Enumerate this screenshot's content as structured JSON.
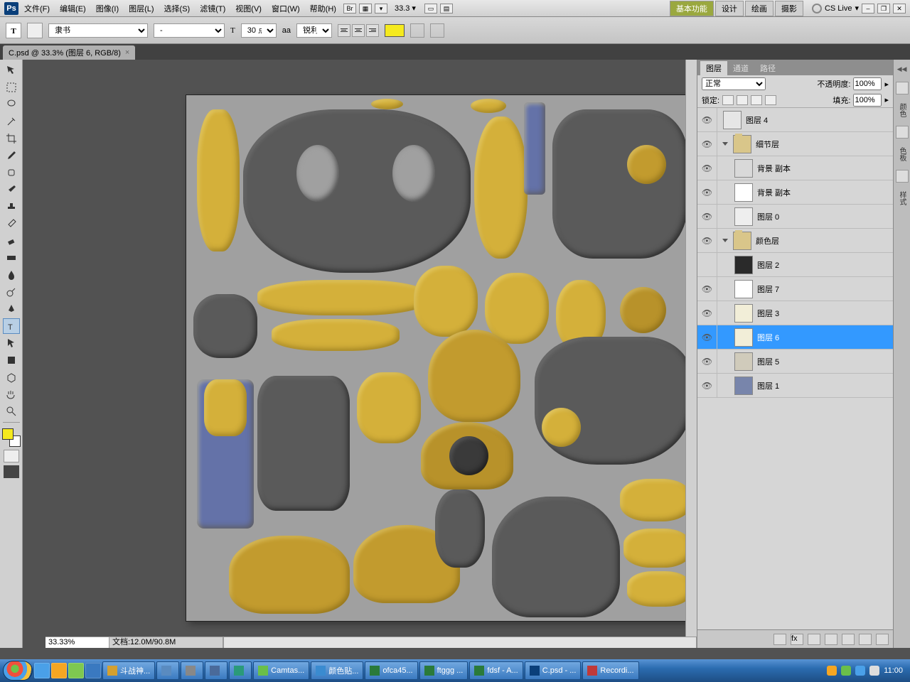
{
  "menu": {
    "items": [
      "文件(F)",
      "编辑(E)",
      "图像(I)",
      "图层(L)",
      "选择(S)",
      "滤镜(T)",
      "视图(V)",
      "窗口(W)",
      "帮助(H)"
    ],
    "zoom": "33.3",
    "workspaces": [
      "基本功能",
      "设计",
      "绘画",
      "摄影"
    ],
    "cslive": "CS Live"
  },
  "options": {
    "fontFamily": "隶书",
    "fontStyle": "-",
    "fontSize": "30 点",
    "fontSizeLabel": "T",
    "aaPrefix": "aa",
    "aaMode": "锐利",
    "colorSwatch": "#f5ea1e"
  },
  "docTab": "C.psd @ 33.3% (图层 6, RGB/8)",
  "statusBar": {
    "zoom": "33.33%",
    "docInfo": "文档:12.0M/90.8M"
  },
  "toolsFg": "#f5ea1e",
  "layersPanel": {
    "tabs": [
      "图层",
      "通道",
      "路径"
    ],
    "blendMode": "正常",
    "opacityLabel": "不透明度:",
    "opacity": "100%",
    "lockLabel": "锁定:",
    "fillLabel": "填充:",
    "fill": "100%",
    "rows": [
      {
        "vis": true,
        "indent": 0,
        "type": "layer",
        "thumb": "#e6e6e6",
        "name": "图层 4"
      },
      {
        "vis": true,
        "indent": 0,
        "type": "group",
        "name": "细节层"
      },
      {
        "vis": true,
        "indent": 1,
        "type": "layer",
        "thumb": "#d9d9d9",
        "name": "背景 副本"
      },
      {
        "vis": true,
        "indent": 1,
        "type": "layer",
        "thumb": "#ffffff",
        "name": "背景 副本"
      },
      {
        "vis": true,
        "indent": 1,
        "type": "layer",
        "thumb": "#eeeeee",
        "name": "图层 0"
      },
      {
        "vis": true,
        "indent": 0,
        "type": "group",
        "name": "颜色层"
      },
      {
        "vis": false,
        "indent": 1,
        "type": "layer",
        "thumb": "#2a2a2a",
        "name": "图层 2"
      },
      {
        "vis": true,
        "indent": 1,
        "type": "layer",
        "thumb": "#ffffff",
        "name": "图层 7"
      },
      {
        "vis": true,
        "indent": 1,
        "type": "layer",
        "thumb": "#f2eed8",
        "name": "图层 3"
      },
      {
        "vis": true,
        "indent": 1,
        "type": "layer",
        "thumb": "#f2eed8",
        "name": "图层 6",
        "selected": true
      },
      {
        "vis": true,
        "indent": 1,
        "type": "layer",
        "thumb": "#d0cbbb",
        "name": "图层 5"
      },
      {
        "vis": true,
        "indent": 1,
        "type": "layer",
        "thumb": "#7885ab",
        "name": "图层 1"
      }
    ]
  },
  "collapsedPanels": [
    "颜色",
    "色板",
    "样式"
  ],
  "taskbar": {
    "tasks": [
      "斗战神...",
      "",
      "",
      "",
      "",
      "Camtas...",
      "颜色贴...",
      "ofca45...",
      "ftggg ...",
      "fdsf - A...",
      "C.psd - ...",
      "Recordi..."
    ],
    "time": "11:00"
  }
}
